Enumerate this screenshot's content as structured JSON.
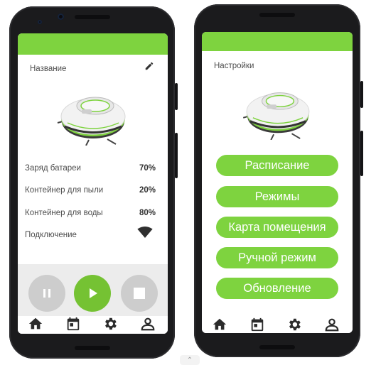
{
  "left_phone": {
    "device_name": "Название",
    "stats": [
      {
        "label": "Заряд батареи",
        "value": "70%"
      },
      {
        "label": "Контейнер для пыли",
        "value": "20%"
      },
      {
        "label": "Контейнер для воды",
        "value": "80%"
      },
      {
        "label": "Подключение",
        "value": ""
      }
    ],
    "controls": [
      "pause",
      "play",
      "stop"
    ]
  },
  "right_phone": {
    "title": "Настройки",
    "menu": [
      {
        "label": "Расписание"
      },
      {
        "label": "Режимы"
      },
      {
        "label": "Карта помещения"
      },
      {
        "label": "Ручной режим"
      },
      {
        "label": "Обновление"
      }
    ]
  },
  "nav": [
    "home-icon",
    "calendar-icon",
    "gear-icon",
    "profile-icon"
  ],
  "colors": {
    "accent": "#7ed33f",
    "play": "#75c233",
    "control_grey": "#cdcdcd",
    "control_bg": "#ececec"
  }
}
